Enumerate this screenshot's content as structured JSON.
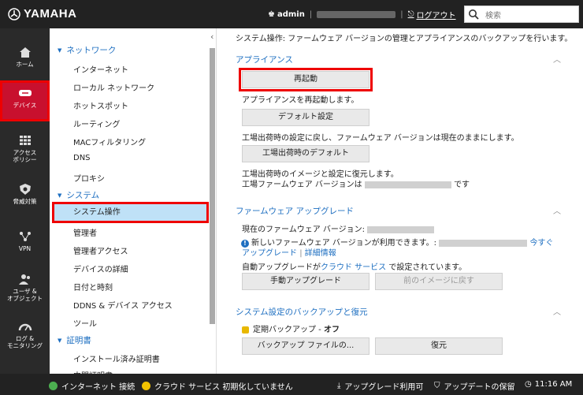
{
  "header": {
    "logo": "YAMAHA",
    "user": "admin",
    "logout": "ログアウト",
    "search_placeholder": "検索"
  },
  "leftnav": [
    {
      "label": "ホーム",
      "icon": "home-icon"
    },
    {
      "label": "デバイス",
      "icon": "device-icon"
    },
    {
      "label": "アクセス\nポリシー",
      "icon": "grid-icon"
    },
    {
      "label": "脅威対策",
      "icon": "shield-icon"
    },
    {
      "label": "VPN",
      "icon": "network-icon"
    },
    {
      "label": "ユーザ &\nオブジェクト",
      "icon": "users-icon"
    },
    {
      "label": "ログ &\nモニタリング",
      "icon": "gauge-icon"
    }
  ],
  "subnav": {
    "network": {
      "title": "ネットワーク",
      "items": [
        "インターネット",
        "ローカル ネットワーク",
        "ホットスポット",
        "ルーティング",
        "MACフィルタリング",
        "DNS",
        "プロキシ"
      ]
    },
    "system": {
      "title": "システム",
      "items": [
        "システム操作",
        "管理者",
        "管理者アクセス",
        "デバイスの詳細",
        "日付と時刻",
        "DDNS & デバイス アクセス",
        "ツール"
      ]
    },
    "cert": {
      "title": "証明書",
      "items": [
        "インストール済み証明書",
        "中間証明書"
      ]
    }
  },
  "main": {
    "description": "システム操作: ファームウェア バージョンの管理とアプライアンスのバックアップを行います。",
    "appliance": {
      "title": "アプライアンス",
      "reboot_button": "再起動",
      "reboot_desc": "アプライアンスを再起動します。",
      "default_button": "デフォルト設定",
      "default_desc": "工場出荷時の設定に戻し、ファームウェア バージョンは現在のままにします。",
      "factory_button": "工場出荷時のデフォルト",
      "factory_desc1": "工場出荷時のイメージと設定に復元します。",
      "factory_desc2a": "工場ファームウェア バージョンは",
      "factory_desc2b": "です"
    },
    "firmware": {
      "title": "ファームウェア アップグレード",
      "current": "現在のファームウェア バージョン:",
      "new_avail": "新しいファームウェア バージョンが利用できます。:",
      "upgrade_now": "今すぐ",
      "upgrade_link": "アップグレード",
      "details_link": "詳細情報",
      "auto_a": "自動アップグレードが",
      "auto_link": "クラウド サービス",
      "auto_b": "で設定されています。",
      "manual_button": "手動アップグレード",
      "revert_button": "前のイメージに戻す"
    },
    "backup": {
      "title": "システム設定のバックアップと復元",
      "scheduled_label": "定期バックアップ -",
      "scheduled_value": "オフ",
      "backup_button": "バックアップ ファイルの...",
      "restore_button": "復元"
    }
  },
  "status": {
    "internet": "インターネット 接続",
    "cloud": "クラウド サービス 初期化していません",
    "upgrade": "アップグレード利用可",
    "update": "アップデートの保留",
    "time": "11:16 AM"
  }
}
